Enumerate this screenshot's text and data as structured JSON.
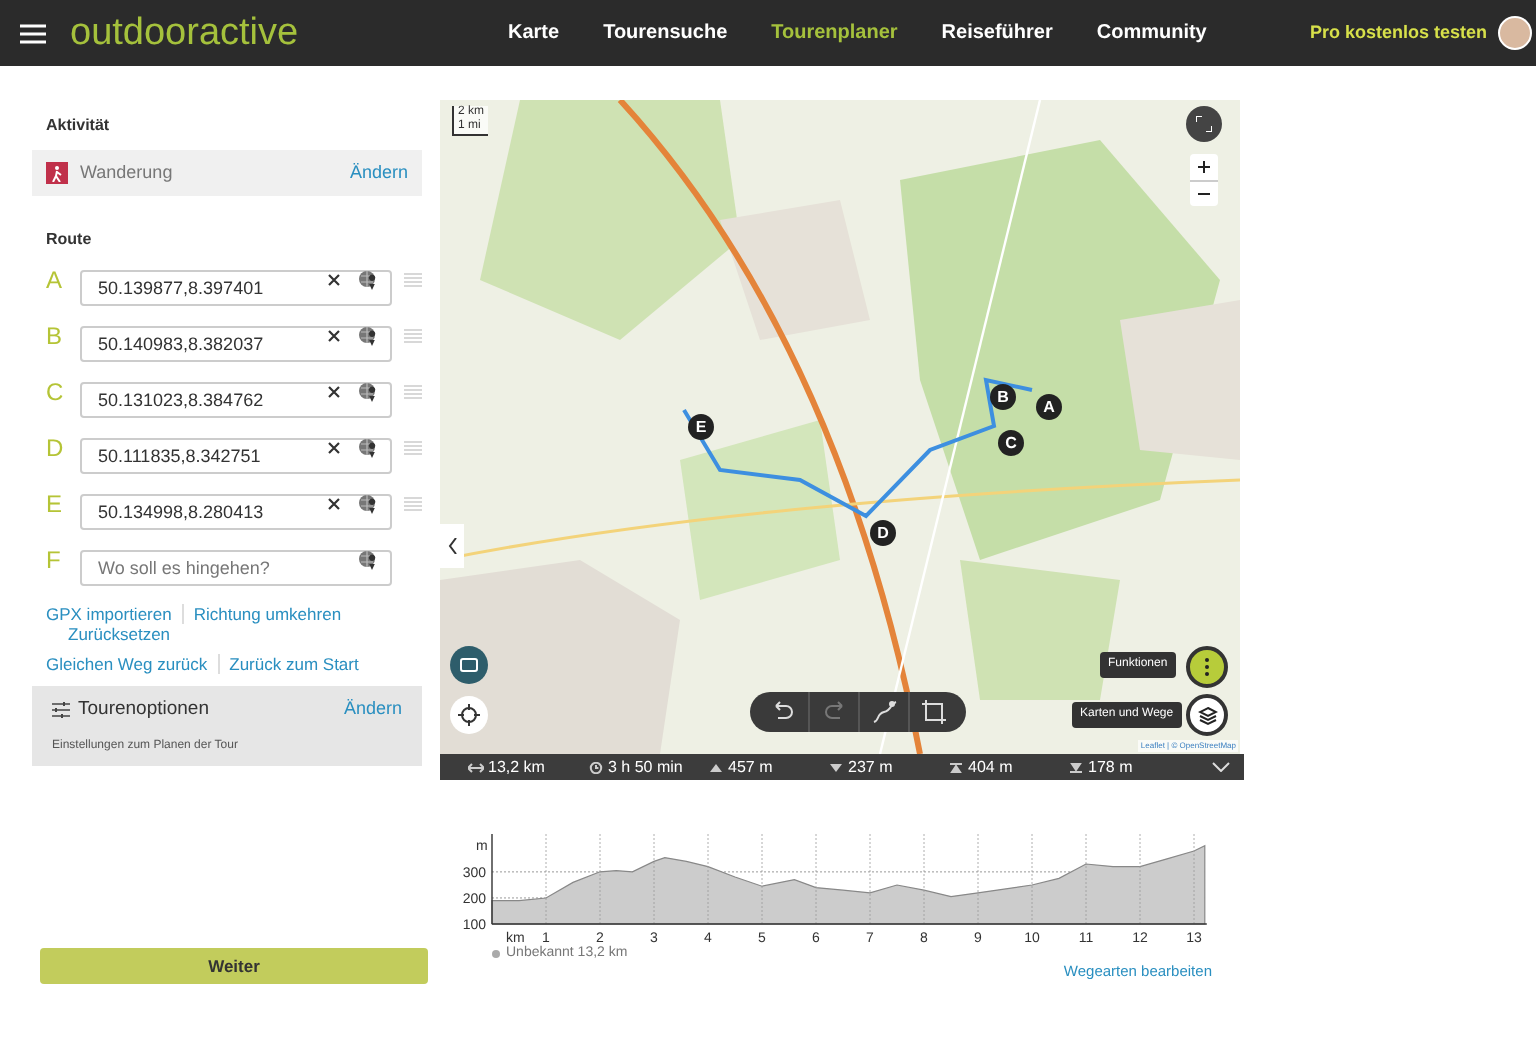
{
  "header": {
    "logo": "outdooractive",
    "nav": [
      {
        "label": "Karte",
        "selected": false
      },
      {
        "label": "Tourensuche",
        "selected": false
      },
      {
        "label": "Tourenplaner",
        "selected": true
      },
      {
        "label": "Reiseführer",
        "selected": false
      },
      {
        "label": "Community",
        "selected": false
      }
    ],
    "cta": "Pro kostenlos testen"
  },
  "sidebar": {
    "activity_label": "Aktivität",
    "activity": "Wanderung",
    "activity_change": "Ändern",
    "route_label": "Route",
    "waypoints": [
      {
        "letter": "A",
        "value": "50.139877,8.397401"
      },
      {
        "letter": "B",
        "value": "50.140983,8.382037"
      },
      {
        "letter": "C",
        "value": "50.131023,8.384762"
      },
      {
        "letter": "D",
        "value": "50.111835,8.342751"
      },
      {
        "letter": "E",
        "value": "50.134998,8.280413"
      },
      {
        "letter": "F",
        "placeholder": "Wo soll es hingehen?"
      }
    ],
    "links_row1": [
      "GPX importieren",
      "Richtung umkehren"
    ],
    "link_reset": "Zurücksetzen",
    "links_row2": [
      "Gleichen Weg zurück",
      "Zurück zum Start"
    ],
    "options": {
      "title": "Tourenoptionen",
      "change": "Ändern",
      "description": "Einstellungen zum Planen der Tour"
    },
    "next_button": "Weiter"
  },
  "map": {
    "markers": [
      "A",
      "B",
      "C",
      "D",
      "E"
    ],
    "scale": [
      "2 km",
      "1 mi"
    ],
    "attribution": "Leaflet | © OpenStreetMap",
    "tooltips": [
      "Funktionen",
      "Karten und Wege"
    ]
  },
  "stats": [
    {
      "kind": "distance",
      "value": "13,2 km"
    },
    {
      "kind": "duration",
      "value": "3 h 50 min"
    },
    {
      "kind": "ascent",
      "value": "457 m"
    },
    {
      "kind": "descent",
      "value": "237 m"
    },
    {
      "kind": "highest",
      "value": "404 m"
    },
    {
      "kind": "lowest",
      "value": "178 m"
    }
  ],
  "elevation": {
    "chart_data": {
      "type": "area",
      "xlabel": "km",
      "ylabel": "m",
      "x": [
        0,
        0.5,
        1,
        1.5,
        2,
        2.3,
        2.6,
        3,
        3.2,
        3.6,
        4,
        4.5,
        5,
        5.6,
        6,
        6.5,
        7,
        7.5,
        8,
        8.5,
        9,
        10,
        10.5,
        11,
        11.5,
        12,
        12.5,
        13,
        13.2
      ],
      "grid": true,
      "series": [
        {
          "color": "#cccccc",
          "values": [
            190,
            190,
            200,
            260,
            300,
            305,
            300,
            340,
            355,
            340,
            320,
            280,
            245,
            270,
            240,
            230,
            220,
            250,
            230,
            205,
            220,
            250,
            275,
            330,
            320,
            320,
            350,
            380,
            400
          ]
        }
      ],
      "xlim": [
        0,
        13.2
      ],
      "ylim": [
        100,
        430
      ],
      "xticks": [
        1,
        2,
        3,
        4,
        5,
        6,
        7,
        8,
        9,
        10,
        11,
        12,
        13
      ],
      "yticks": [
        100,
        200,
        300
      ]
    },
    "legend": "Unbekannt 13,2 km",
    "edit_link": "Wegearten bearbeiten"
  }
}
